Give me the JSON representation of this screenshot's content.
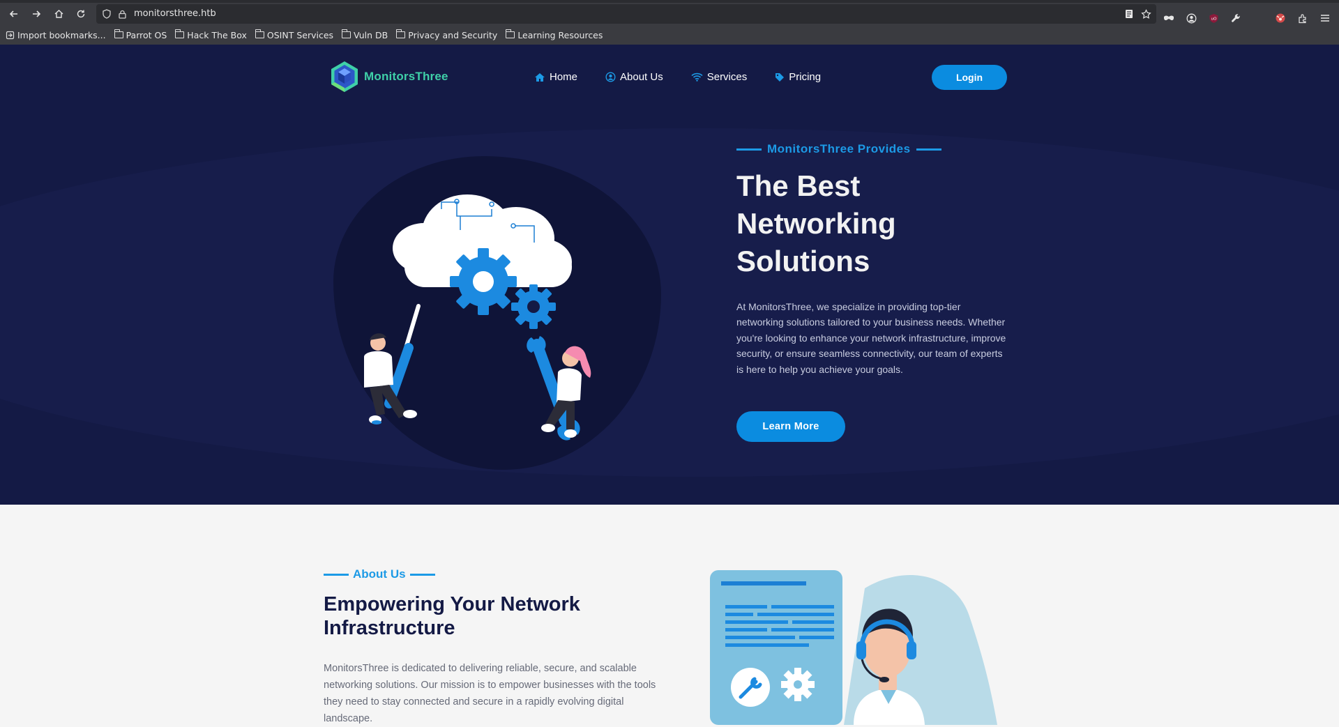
{
  "browser": {
    "url": "monitorsthree.htb",
    "bookmarks": [
      {
        "label": "Import bookmarks...",
        "icon": "import-icon"
      },
      {
        "label": "Parrot OS",
        "icon": "folder-icon"
      },
      {
        "label": "Hack The Box",
        "icon": "folder-icon"
      },
      {
        "label": "OSINT Services",
        "icon": "folder-icon"
      },
      {
        "label": "Vuln DB",
        "icon": "folder-icon"
      },
      {
        "label": "Privacy and Security",
        "icon": "folder-icon"
      },
      {
        "label": "Learning Resources",
        "icon": "folder-icon"
      }
    ]
  },
  "header": {
    "logo_text": "MonitorsThree",
    "nav": [
      {
        "label": "Home",
        "icon": "home-icon"
      },
      {
        "label": "About Us",
        "icon": "user-circle-icon"
      },
      {
        "label": "Services",
        "icon": "wifi-icon"
      },
      {
        "label": "Pricing",
        "icon": "tag-icon"
      }
    ],
    "login_label": "Login"
  },
  "hero": {
    "tagline": "MonitorsThree Provides",
    "title": "The Best Networking Solutions",
    "description": "At MonitorsThree, we specialize in providing top-tier networking solutions tailored to your business needs. Whether you're looking to enhance your network infrastructure, improve security, or ensure seamless connectivity, our team of experts is here to help you achieve your goals.",
    "cta_label": "Learn More"
  },
  "about": {
    "tagline": "About Us",
    "title": "Empowering Your Network Infrastructure",
    "description": "MonitorsThree is dedicated to delivering reliable, secure, and scalable networking solutions. Our mission is to empower businesses with the tools they need to stay connected and secure in a rapidly evolving digital landscape."
  },
  "colors": {
    "hero_bg": "#141a45",
    "accent": "#1c9ae6",
    "button": "#0b8ce0",
    "logo_green": "#3fd0a8",
    "about_bg": "#f5f5f5"
  }
}
